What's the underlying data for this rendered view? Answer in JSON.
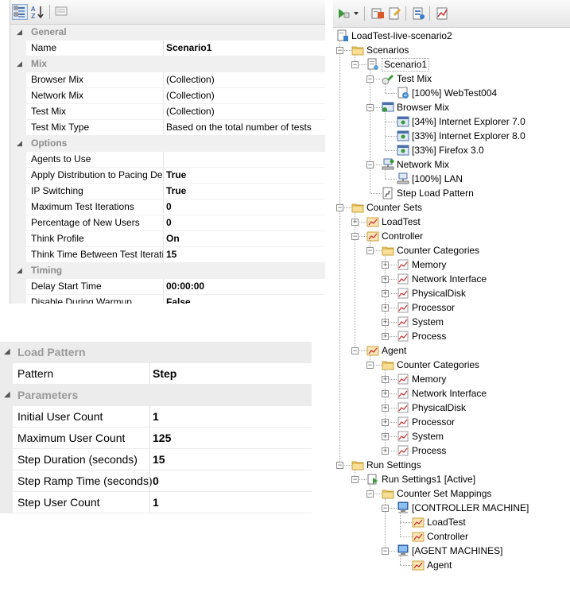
{
  "properties": {
    "toolbar": [
      "categorized-icon",
      "alphabetical-icon",
      "property-pages-icon"
    ],
    "rows": [
      {
        "type": "cat",
        "label": "General"
      },
      {
        "type": "prop",
        "name": "Name",
        "value": "Scenario1",
        "bold": true
      },
      {
        "type": "cat",
        "label": "Mix"
      },
      {
        "type": "prop",
        "name": "Browser Mix",
        "value": "(Collection)",
        "bold": false
      },
      {
        "type": "prop",
        "name": "Network Mix",
        "value": "(Collection)",
        "bold": false
      },
      {
        "type": "prop",
        "name": "Test Mix",
        "value": "(Collection)",
        "bold": false
      },
      {
        "type": "prop",
        "name": "Test Mix Type",
        "value": "Based on the total number of tests",
        "bold": false
      },
      {
        "type": "cat",
        "label": "Options"
      },
      {
        "type": "prop",
        "name": "Agents to Use",
        "value": "",
        "bold": false
      },
      {
        "type": "prop",
        "name": "Apply Distribution to Pacing De",
        "value": "True",
        "bold": true
      },
      {
        "type": "prop",
        "name": "IP Switching",
        "value": "True",
        "bold": true
      },
      {
        "type": "prop",
        "name": "Maximum Test Iterations",
        "value": "0",
        "bold": true
      },
      {
        "type": "prop",
        "name": "Percentage of New Users",
        "value": "0",
        "bold": true
      },
      {
        "type": "prop",
        "name": "Think Profile",
        "value": "On",
        "bold": true
      },
      {
        "type": "prop",
        "name": "Think Time Between Test Iterati",
        "value": "15",
        "bold": true
      },
      {
        "type": "cat",
        "label": "Timing"
      },
      {
        "type": "prop",
        "name": "Delay Start Time",
        "value": "00:00:00",
        "bold": true
      },
      {
        "type": "prop",
        "name": "Disable During Warmup",
        "value": "False",
        "bold": true
      }
    ]
  },
  "load_pattern": {
    "rows": [
      {
        "type": "cat",
        "label": "Load Pattern"
      },
      {
        "type": "prop",
        "name": "Pattern",
        "value": "Step"
      },
      {
        "type": "cat",
        "label": "Parameters"
      },
      {
        "type": "prop",
        "name": "Initial User Count",
        "value": "1"
      },
      {
        "type": "prop",
        "name": "Maximum User Count",
        "value": "125"
      },
      {
        "type": "prop",
        "name": "Step Duration (seconds)",
        "value": "15"
      },
      {
        "type": "prop",
        "name": "Step Ramp Time (seconds)",
        "value": "0"
      },
      {
        "type": "prop",
        "name": "Step User Count",
        "value": "1"
      }
    ]
  },
  "tree": {
    "toolbar": [
      "run-test-icon",
      "dropdown-arrow-icon",
      "add-scenario-icon",
      "edit-icon",
      "manage-counter-sets-icon",
      "analyze-icon"
    ],
    "nodes": [
      {
        "level": 0,
        "label": "LoadTest-live-scenario2",
        "icon": "loadtest-icon",
        "exp": ""
      },
      {
        "level": 1,
        "label": "Scenarios",
        "icon": "folder-icon",
        "exp": "-"
      },
      {
        "level": 2,
        "label": "Scenario1",
        "icon": "scenario-icon",
        "exp": "-",
        "selected": true
      },
      {
        "level": 3,
        "label": "Test Mix",
        "icon": "test-mix-icon",
        "exp": "-"
      },
      {
        "level": 4,
        "label": "[100%] WebTest004",
        "icon": "webtest-icon",
        "exp": ""
      },
      {
        "level": 3,
        "label": "Browser Mix",
        "icon": "browser-mix-icon",
        "exp": "-"
      },
      {
        "level": 4,
        "label": "[34%] Internet Explorer 7.0",
        "icon": "browser-icon",
        "exp": ""
      },
      {
        "level": 4,
        "label": "[33%] Internet Explorer 8.0",
        "icon": "browser-icon",
        "exp": ""
      },
      {
        "level": 4,
        "label": "[33%] Firefox 3.0",
        "icon": "browser-icon",
        "exp": ""
      },
      {
        "level": 3,
        "label": "Network Mix",
        "icon": "network-mix-icon",
        "exp": "-"
      },
      {
        "level": 4,
        "label": "[100%] LAN",
        "icon": "network-icon",
        "exp": ""
      },
      {
        "level": 3,
        "label": "Step Load Pattern",
        "icon": "load-pattern-icon",
        "exp": ""
      },
      {
        "level": 1,
        "label": "Counter Sets",
        "icon": "folder-icon",
        "exp": "-"
      },
      {
        "level": 2,
        "label": "LoadTest",
        "icon": "counter-set-icon",
        "exp": "+"
      },
      {
        "level": 2,
        "label": "Controller",
        "icon": "counter-set-icon",
        "exp": "-"
      },
      {
        "level": 3,
        "label": "Counter Categories",
        "icon": "folder-icon",
        "exp": "-"
      },
      {
        "level": 4,
        "label": "Memory",
        "icon": "counter-icon",
        "exp": "+"
      },
      {
        "level": 4,
        "label": "Network Interface",
        "icon": "counter-icon",
        "exp": "+"
      },
      {
        "level": 4,
        "label": "PhysicalDisk",
        "icon": "counter-icon",
        "exp": "+"
      },
      {
        "level": 4,
        "label": "Processor",
        "icon": "counter-icon",
        "exp": "+"
      },
      {
        "level": 4,
        "label": "System",
        "icon": "counter-icon",
        "exp": "+"
      },
      {
        "level": 4,
        "label": "Process",
        "icon": "counter-icon",
        "exp": "+"
      },
      {
        "level": 2,
        "label": "Agent",
        "icon": "counter-set-icon",
        "exp": "-"
      },
      {
        "level": 3,
        "label": "Counter Categories",
        "icon": "folder-icon",
        "exp": "-"
      },
      {
        "level": 4,
        "label": "Memory",
        "icon": "counter-icon",
        "exp": "+"
      },
      {
        "level": 4,
        "label": "Network Interface",
        "icon": "counter-icon",
        "exp": "+"
      },
      {
        "level": 4,
        "label": "PhysicalDisk",
        "icon": "counter-icon",
        "exp": "+"
      },
      {
        "level": 4,
        "label": "Processor",
        "icon": "counter-icon",
        "exp": "+"
      },
      {
        "level": 4,
        "label": "System",
        "icon": "counter-icon",
        "exp": "+"
      },
      {
        "level": 4,
        "label": "Process",
        "icon": "counter-icon",
        "exp": "+"
      },
      {
        "level": 1,
        "label": "Run Settings",
        "icon": "folder-icon",
        "exp": "-"
      },
      {
        "level": 2,
        "label": "Run Settings1 [Active]",
        "icon": "run-settings-icon",
        "exp": "-"
      },
      {
        "level": 3,
        "label": "Counter Set Mappings",
        "icon": "folder-icon",
        "exp": "-"
      },
      {
        "level": 4,
        "label": "[CONTROLLER MACHINE]",
        "icon": "computer-icon",
        "exp": "-"
      },
      {
        "level": 5,
        "label": "LoadTest",
        "icon": "counter-set-icon",
        "exp": ""
      },
      {
        "level": 5,
        "label": "Controller",
        "icon": "counter-set-icon",
        "exp": ""
      },
      {
        "level": 4,
        "label": "[AGENT MACHINES]",
        "icon": "computer-icon",
        "exp": "-"
      },
      {
        "level": 5,
        "label": "Agent",
        "icon": "counter-set-icon",
        "exp": ""
      }
    ]
  }
}
